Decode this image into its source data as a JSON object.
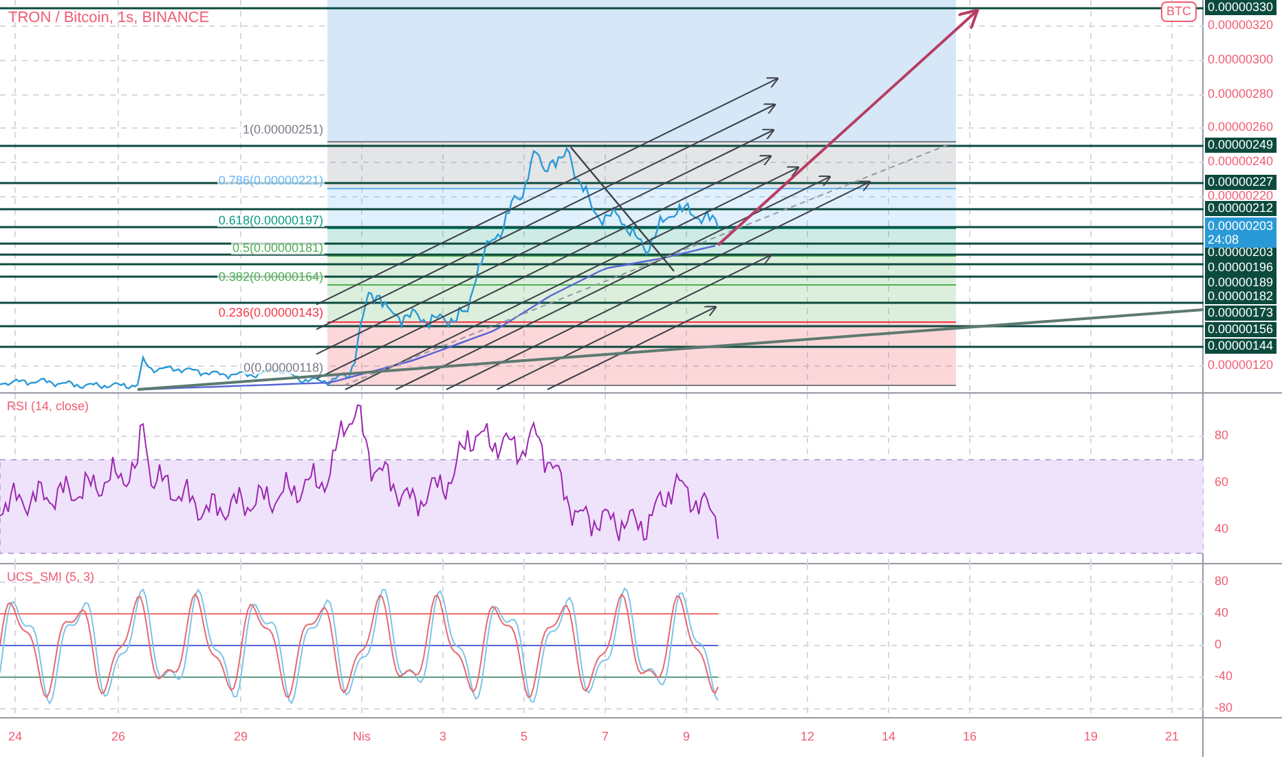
{
  "symbol_title": "TRON / Bitcoin, 1s, BINANCE",
  "currency_badge": "BTC",
  "price_ticks": [
    "0.00000320",
    "0.00000300",
    "0.00000280",
    "0.00000260",
    "0.00000240",
    "0.00000220",
    "0.00000120"
  ],
  "line_labels": [
    "0.00000330",
    "0.00000249",
    "0.00000227",
    "0.00000212",
    "0.00000203",
    "0.00000196",
    "0.00000189",
    "0.00000182",
    "0.00000173",
    "0.00000156",
    "0.00000144"
  ],
  "current_price": {
    "price": "0.00000203",
    "countdown": "24:08"
  },
  "fib_levels": [
    {
      "label": "1(0.00000251)",
      "color": "#787b86"
    },
    {
      "label": "0.786(0.00000221)",
      "color": "#64b5f6"
    },
    {
      "label": "0.618(0.00000197)",
      "color": "#089981"
    },
    {
      "label": "0.5(0.00000181)",
      "color": "#4caf50"
    },
    {
      "label": "0.382(0.00000164)",
      "color": "#4caf50"
    },
    {
      "label": "0.236(0.00000143)",
      "color": "#f23645"
    },
    {
      "label": "0(0.00000118)",
      "color": "#787b86"
    }
  ],
  "rsi": {
    "title": "RSI (14, close)",
    "ticks": [
      "80",
      "60",
      "40"
    ]
  },
  "smi": {
    "title": "UCS_SMI (5, 3)",
    "ticks": [
      "80",
      "40",
      "0",
      "-40",
      "-80"
    ]
  },
  "time_axis": [
    "24",
    "26",
    "29",
    "Nis",
    "3",
    "5",
    "7",
    "9",
    "12",
    "14",
    "16",
    "19",
    "21"
  ]
}
